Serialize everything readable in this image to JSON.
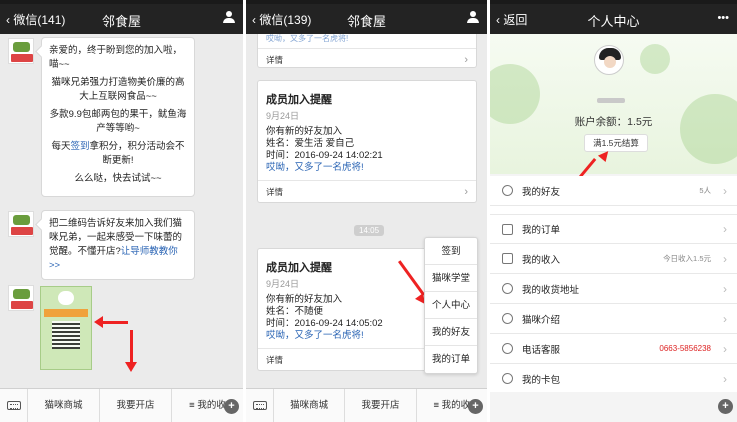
{
  "panel1": {
    "back": "微信(141)",
    "title": "邻食屋",
    "msg1": {
      "line1": "亲爱的，终于盼到您的加入啦，喵~~",
      "line2": "猫咪兄弟强力打造物美价廉的高大上互联网食品~~",
      "line3": "多款9.9包邮两包的果干，鱿鱼海产等等哟~",
      "line4_pre": "每天",
      "line4_link": "签到",
      "line4_post": "拿积分，积分活动会不断更新!",
      "line5": "么么哒，快去试试~~"
    },
    "msg2": {
      "text": "把二维码告诉好友来加入我们猫咪兄弟，一起来感受一下味蕾的觉醒。不懂开店?",
      "link": "让导师教教你>>"
    },
    "menu": [
      "猫咪商城",
      "我要开店",
      "≡ 我的收"
    ]
  },
  "panel2": {
    "back": "微信(139)",
    "title": "邻食屋",
    "top_snippet": "哎呦，又多了一名虎将!",
    "top_detail": "详情",
    "cards": [
      {
        "title": "成员加入提醒",
        "date": "9月24日",
        "line1": "你有新的好友加入",
        "line2": "姓名：爱生活 爱自己",
        "line3": "时间：2016-09-24 14:02:21",
        "line4": "哎呦，又多了一名虎将!",
        "detail": "详情"
      },
      {
        "title": "成员加入提醒",
        "date": "9月24日",
        "line1": "你有新的好友加入",
        "line2": "姓名：不随便",
        "line3": "时间：2016-09-24 14:05:02",
        "line4": "哎呦，又多了一名虎将!",
        "detail": "详情"
      }
    ],
    "time_chip": "14:05",
    "popup": [
      "签到",
      "猫咪学堂",
      "个人中心",
      "我的好友",
      "我的订单"
    ],
    "menu": [
      "猫咪商城",
      "我要开店",
      "≡ 我的收"
    ]
  },
  "panel3": {
    "back": "返回",
    "title": "个人中心",
    "more": "•••",
    "balance": "账户余额：1.5元",
    "settle": "满1.5元结算",
    "rows": [
      {
        "label": "我的好友",
        "value": "5人"
      },
      {
        "label": "我的订单",
        "value": ""
      },
      {
        "label": "我的收入",
        "value": "今日收入1.5元"
      },
      {
        "label": "我的收货地址",
        "value": ""
      },
      {
        "label": "猫咪介绍",
        "value": ""
      },
      {
        "label": "电话客服",
        "value": "0663-5856238"
      },
      {
        "label": "我的卡包",
        "value": ""
      }
    ]
  },
  "colors": {
    "titlebar": "#232323",
    "link": "#2a64b4",
    "annotation_arrow": "#e22222",
    "phone_red": "#d22222"
  }
}
